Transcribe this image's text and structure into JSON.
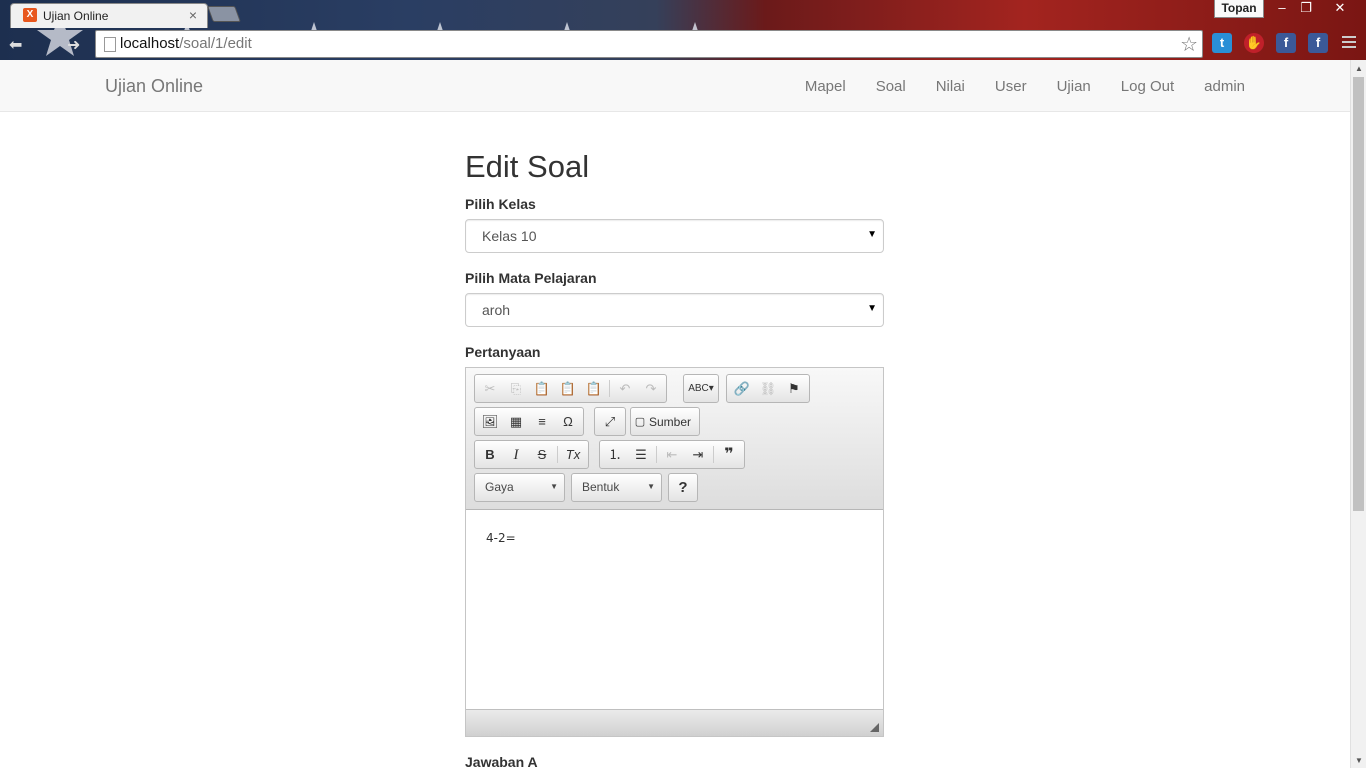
{
  "browser": {
    "tab_title": "Ujian Online",
    "tab_favicon": "X",
    "profile_name": "Topan",
    "url_host": "localhost",
    "url_path": "/soal/1/edit",
    "window_controls": [
      "minimize-icon",
      "restore-icon",
      "close-icon"
    ],
    "extensions": [
      {
        "name": "twitter-icon",
        "glyph": "t",
        "color": "#2a8fd6"
      },
      {
        "name": "adblock-icon",
        "glyph": "✋",
        "color": "#c0202a"
      },
      {
        "name": "facebook-icon",
        "glyph": "f",
        "color": "#3b5998"
      },
      {
        "name": "facebook-icon",
        "glyph": "f",
        "color": "#3b5998"
      }
    ]
  },
  "navbar": {
    "brand": "Ujian Online",
    "links": [
      "Mapel",
      "Soal",
      "Nilai",
      "User",
      "Ujian",
      "Log Out",
      "admin"
    ]
  },
  "form": {
    "heading": "Edit Soal",
    "kelas_label": "Pilih Kelas",
    "kelas_value": "Kelas 10",
    "mapel_label": "Pilih Mata Pelajaran",
    "mapel_value": "aroh",
    "pertanyaan_label": "Pertanyaan",
    "jawaban_a_label": "Jawaban A"
  },
  "editor": {
    "content": "4-2=",
    "source_label": "Sumber",
    "style_combo": "Gaya",
    "format_combo": "Bentuk",
    "help_label": "?",
    "bold": "B",
    "italic": "I",
    "strike": "S",
    "removeformat": "Tx"
  }
}
